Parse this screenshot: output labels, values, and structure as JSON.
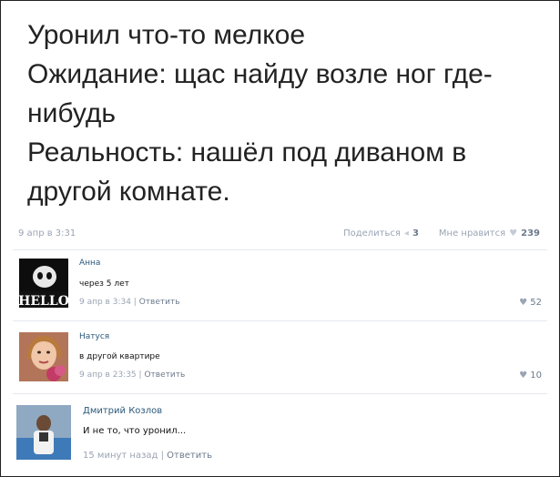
{
  "post": {
    "lines": [
      "Уронил что-то мелкое",
      "Ожидание: щас найду возле ног где-",
      "нибудь",
      "Реальность: нашёл под диваном в",
      "другой комнате."
    ],
    "date": "9 апр в 3:31",
    "share_label": "Поделиться",
    "share_count": "3",
    "like_label": "Мне нравится",
    "like_count": "239"
  },
  "comments": [
    {
      "author": "Анна",
      "text": "через 5 лет",
      "date": "9 апр в 3:34",
      "reply_label": "Ответить",
      "likes": "52",
      "avatar_text": "HELLO"
    },
    {
      "author": "Натуся",
      "text": "в другой квартире",
      "date": "9 апр в 23:35",
      "reply_label": "Ответить",
      "likes": "10"
    },
    {
      "author": "Дмитрий Козлов",
      "text": "И не то, что уронил...",
      "date": "15 минут назад",
      "reply_label": "Ответить"
    }
  ],
  "colors": {
    "name": "#2b587a",
    "meta": "#9aa4b3",
    "text": "#222222"
  },
  "icons": [
    "share-icon",
    "heart-icon"
  ]
}
